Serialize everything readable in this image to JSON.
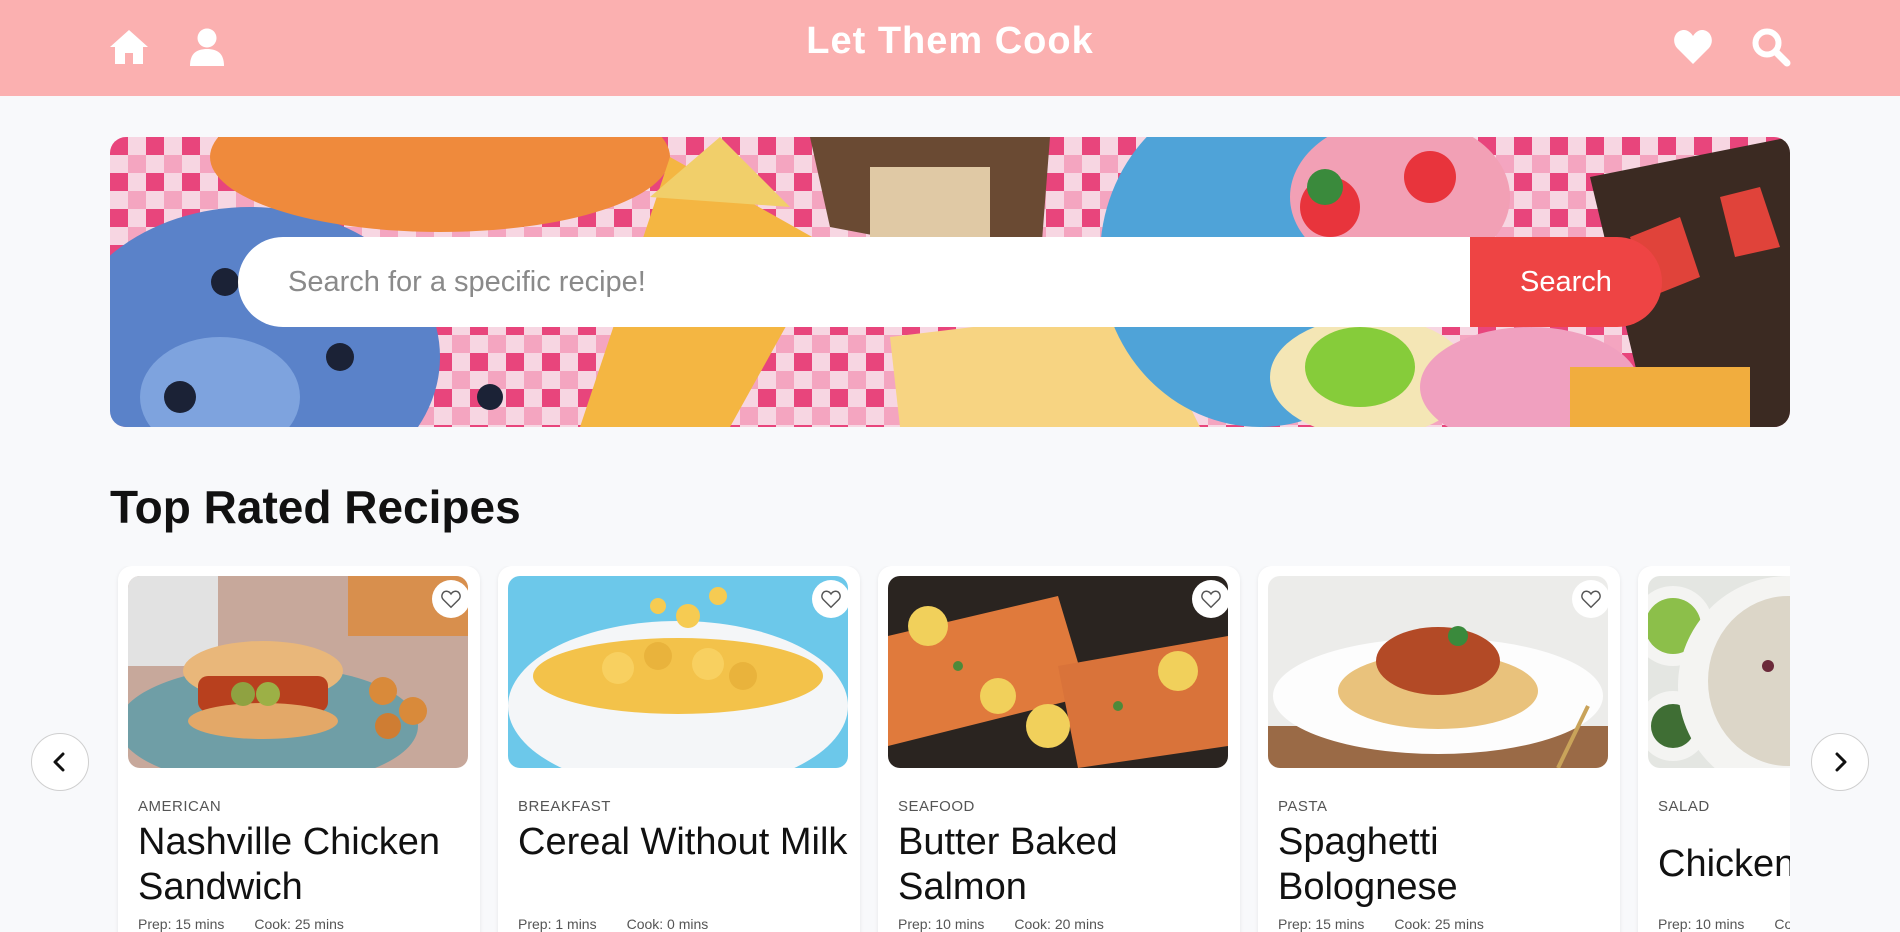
{
  "nav": {
    "brand": "Let Them Cook",
    "icons": [
      "home-icon",
      "user-icon",
      "heart-icon",
      "search-icon"
    ],
    "color": "#fbb0b0"
  },
  "hero": {
    "search_placeholder": "Search for a specific recipe!",
    "search_button": "Search",
    "button_color": "#ee4444"
  },
  "section": {
    "title": "Top Rated Recipes"
  },
  "recipes": [
    {
      "category": "AMERICAN",
      "title": "Nashville Chicken Sandwich",
      "prep": "Prep: 15 mins",
      "cook": "Cook: 25 mins"
    },
    {
      "category": "BREAKFAST",
      "title": "Cereal Without Milk",
      "prep": "Prep: 1 mins",
      "cook": "Cook: 0 mins"
    },
    {
      "category": "SEAFOOD",
      "title": "Butter Baked Salmon",
      "prep": "Prep: 10 mins",
      "cook": "Cook: 20 mins"
    },
    {
      "category": "PASTA",
      "title": "Spaghetti Bolognese",
      "prep": "Prep: 15 mins",
      "cook": "Cook: 25 mins"
    },
    {
      "category": "SALAD",
      "title": "Chicken",
      "prep": "Prep: 10 mins",
      "cook": "Co"
    }
  ]
}
